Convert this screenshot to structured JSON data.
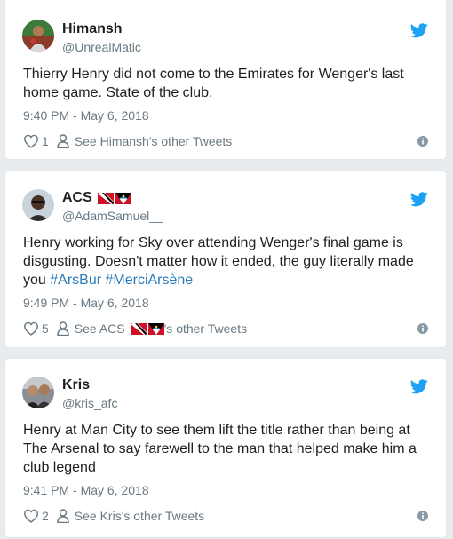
{
  "tweets": [
    {
      "name": "Himansh",
      "handle": "@UnrealMatic",
      "text": "Thierry Henry did not come to the Emirates for Wenger's last home game. State of the club.",
      "time": "9:40 PM - May 6, 2018",
      "likes": "1",
      "other_tweets": "See Himansh's other Tweets"
    },
    {
      "name": "ACS",
      "handle": "@AdamSamuel__",
      "text_parts": [
        "Henry working for Sky over attending Wenger's final game is disgusting. Doesn't matter how it ended, the guy literally made you ",
        "#ArsBur",
        " ",
        "#MerciArsène"
      ],
      "time": "9:49 PM - May 6, 2018",
      "likes": "5",
      "other_prefix": "See ACS",
      "other_suffix": "'s other Tweets",
      "flags": [
        "trinidad-tobago-flag",
        "antigua-flag"
      ]
    },
    {
      "name": "Kris",
      "handle": "@kris_afc",
      "text": "Henry at Man City to see them lift the title rather than being at The Arsenal to say farewell to the man that helped make him a club legend",
      "time": "9:41 PM - May 6, 2018",
      "likes": "2",
      "other_tweets": "See Kris's other Tweets"
    }
  ],
  "colors": {
    "background": "#e9ecee",
    "card": "#ffffff",
    "text": "#1c2022",
    "muted": "#697882",
    "link": "#2b7bb9",
    "twitter_blue": "#1da1f2"
  },
  "icons": [
    "twitter-bird-icon",
    "heart-icon",
    "person-icon",
    "info-icon"
  ]
}
